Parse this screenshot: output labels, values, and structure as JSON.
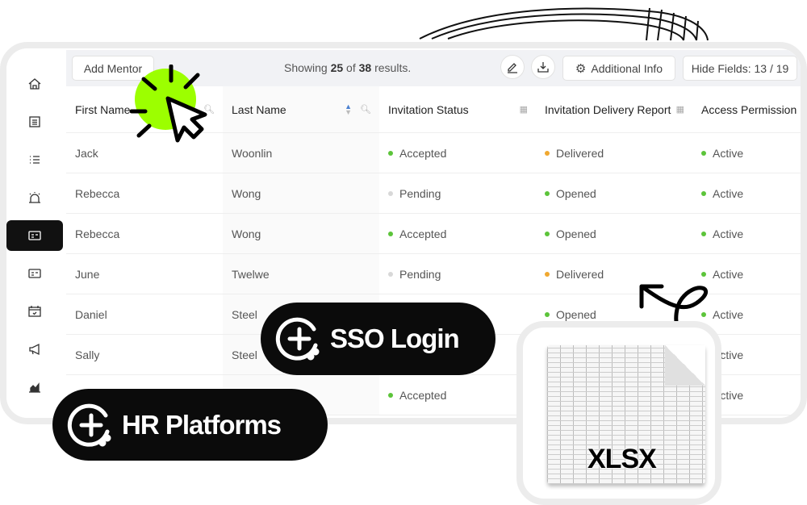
{
  "toolbar": {
    "add_mentor": "Add Mentor",
    "showing_prefix": "Showing ",
    "showing_count": "25",
    "showing_mid": " of ",
    "showing_total": "38",
    "showing_suffix": " results.",
    "additional_info": "Additional Info",
    "hide_fields": "Hide Fields: 13 / 19"
  },
  "sidebar": {
    "items": [
      {
        "icon": "home-icon"
      },
      {
        "icon": "list-box-icon"
      },
      {
        "icon": "list-icon"
      },
      {
        "icon": "alarm-icon"
      },
      {
        "icon": "id-card-icon",
        "active": true
      },
      {
        "icon": "id-card-icon"
      },
      {
        "icon": "calendar-icon"
      },
      {
        "icon": "megaphone-icon"
      },
      {
        "icon": "chart-icon"
      }
    ]
  },
  "table": {
    "headers": [
      "First Name",
      "Last Name",
      "Invitation Status",
      "Invitation Delivery Report",
      "Access Permission"
    ],
    "rows": [
      [
        "Jack",
        "Woonlin",
        "Accepted",
        "Delivered",
        "Active"
      ],
      [
        "Rebecca",
        "Wong",
        "Pending",
        "Opened",
        "Active"
      ],
      [
        "Rebecca",
        "Wong",
        "Accepted",
        "Opened",
        "Active"
      ],
      [
        "June",
        "Twelwe",
        "Pending",
        "Delivered",
        "Active"
      ],
      [
        "Daniel",
        "Steel",
        "",
        "Opened",
        "Active"
      ],
      [
        "Sally",
        "Steel",
        "",
        "",
        "Active"
      ],
      [
        "",
        "",
        "Accepted",
        "",
        "Active"
      ]
    ]
  },
  "status_colors": {
    "Accepted": "#5cc43a",
    "Pending": "#d8d8d8",
    "Delivered": "#f0a830",
    "Opened": "#5cc43a",
    "Active": "#5cc43a"
  },
  "badges": {
    "sso": "SSO Login",
    "hr": "HR Platforms"
  },
  "file": {
    "label": "XLSX"
  },
  "accent": "#9cff00"
}
